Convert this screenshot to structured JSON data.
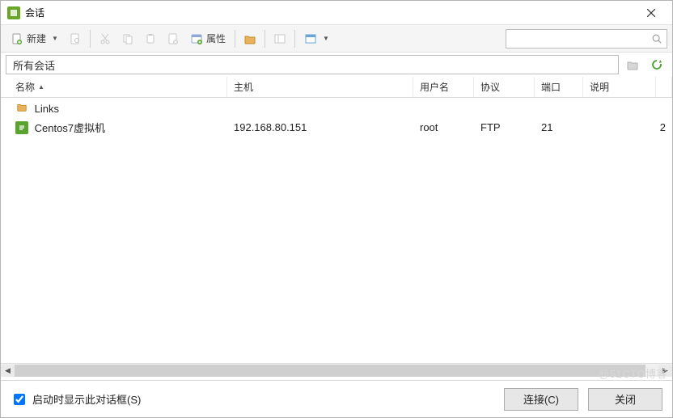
{
  "window": {
    "title": "会话"
  },
  "toolbar": {
    "new_label": "新建",
    "props_label": "属性"
  },
  "breadcrumb": {
    "path": "所有会话"
  },
  "columns": {
    "name": "名称",
    "host": "主机",
    "user": "用户名",
    "protocol": "协议",
    "port": "端口",
    "desc": "说明"
  },
  "rows": [
    {
      "icon": "folder",
      "name": "Links",
      "host": "",
      "user": "",
      "protocol": "",
      "port": "",
      "desc": ""
    },
    {
      "icon": "session",
      "name": "Centos7虚拟机",
      "host": "192.168.80.151",
      "user": "root",
      "protocol": "FTP",
      "port": "21",
      "desc": ""
    }
  ],
  "rightedge": "2",
  "footer": {
    "startup_label": "启动时显示此对话框(S)",
    "connect": "连接(C)",
    "close": "关闭"
  },
  "watermark": "@51CTO博客"
}
